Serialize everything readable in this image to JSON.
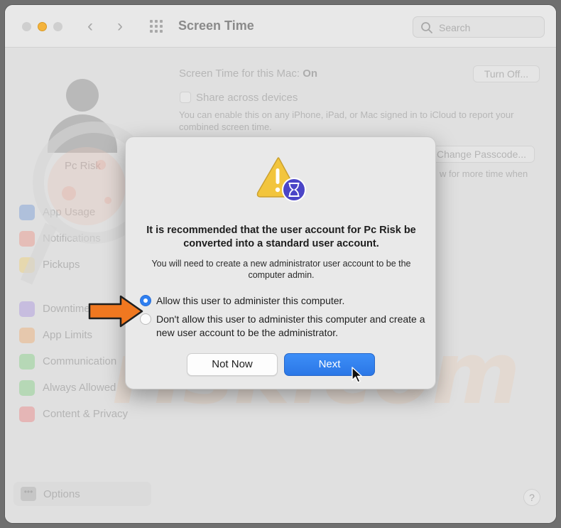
{
  "window": {
    "title": "Screen Time",
    "search_placeholder": "Search"
  },
  "sidebar": {
    "user_name": "Pc Risk",
    "items": [
      {
        "label": "App Usage",
        "icon": "app-usage-icon",
        "color": "#9db7e0"
      },
      {
        "label": "Notifications",
        "icon": "bell-icon",
        "color": "#f0b3aa"
      },
      {
        "label": "Pickups",
        "icon": "pickups-icon",
        "color": "#f2dc9c"
      },
      {
        "label": "Downtime",
        "icon": "downtime-icon",
        "color": "#c2b2e6"
      },
      {
        "label": "App Limits",
        "icon": "hourglass-icon",
        "color": "#f2c49a"
      },
      {
        "label": "Communication",
        "icon": "communication-icon",
        "color": "#a8dca8"
      },
      {
        "label": "Always Allowed",
        "icon": "checkmark-icon",
        "color": "#a8dca8"
      },
      {
        "label": "Content & Privacy",
        "icon": "no-entry-icon",
        "color": "#f0a8a8"
      }
    ],
    "options_label": "Options"
  },
  "main": {
    "status_label": "Screen Time for this Mac:",
    "status_value": "On",
    "turn_off_label": "Turn Off...",
    "share_label": "Share across devices",
    "share_desc_1": "You can enable this on any iPhone, iPad, or Mac signed in to iCloud to report your",
    "share_desc_2": "combined screen time.",
    "change_passcode_label": "Change Passcode...",
    "more_time_text": "w for more time when"
  },
  "dialog": {
    "title": "It is recommended that the user account for Pc Risk be converted into a standard user account.",
    "subtitle": "You will need to create a new administrator user account to be the computer admin.",
    "option_allow": "Allow this user to administer this computer.",
    "option_disallow": "Don't allow this user to administer this computer and create a new user account to be the administrator.",
    "selected_option": "allow",
    "not_now_label": "Not Now",
    "next_label": "Next"
  },
  "help_label": "?",
  "colors": {
    "accent": "#2f7ff0",
    "arrow": "#f07820",
    "warning": "#f2c53d",
    "hourglass_badge": "#4b45c7"
  }
}
